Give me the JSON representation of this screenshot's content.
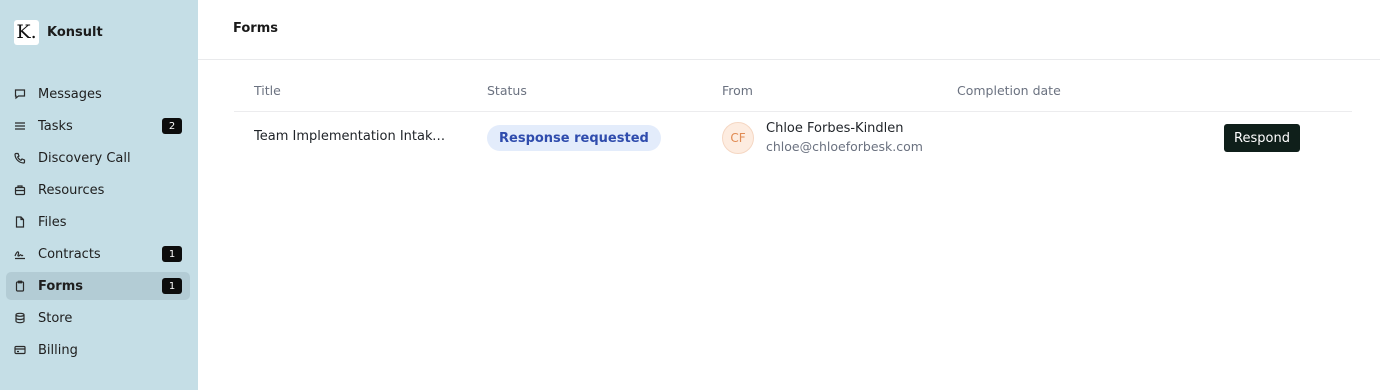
{
  "brand": {
    "logo": "K.",
    "name": "Konsult"
  },
  "sidebar": {
    "items": [
      {
        "label": "Messages",
        "icon": "chat-bubble-icon",
        "badge": null,
        "active": false
      },
      {
        "label": "Tasks",
        "icon": "list-icon",
        "badge": "2",
        "active": false
      },
      {
        "label": "Discovery Call",
        "icon": "phone-icon",
        "badge": null,
        "active": false
      },
      {
        "label": "Resources",
        "icon": "briefcase-icon",
        "badge": null,
        "active": false
      },
      {
        "label": "Files",
        "icon": "file-icon",
        "badge": null,
        "active": false
      },
      {
        "label": "Contracts",
        "icon": "signature-icon",
        "badge": "1",
        "active": false
      },
      {
        "label": "Forms",
        "icon": "clipboard-icon",
        "badge": "1",
        "active": true
      },
      {
        "label": "Store",
        "icon": "database-icon",
        "badge": null,
        "active": false
      },
      {
        "label": "Billing",
        "icon": "credit-card-icon",
        "badge": null,
        "active": false
      }
    ]
  },
  "page": {
    "title": "Forms"
  },
  "table": {
    "columns": [
      "Title",
      "Status",
      "From",
      "Completion date"
    ],
    "rows": [
      {
        "title": "Team Implementation Intake Form",
        "status": "Response requested",
        "from_initials": "CF",
        "from_name": "Chloe Forbes-Kindlen",
        "from_email": "chloe@chloeforbesk.com",
        "completion_date": "",
        "action": "Respond"
      }
    ]
  },
  "colors": {
    "sidebar_bg": "#c5dee6",
    "active_item_bg": "#b3ccd5",
    "badge_bg": "#0d0d0d",
    "status_bg": "#e3ecfb",
    "status_text": "#2f4cad",
    "button_bg": "#0f1f1a"
  }
}
